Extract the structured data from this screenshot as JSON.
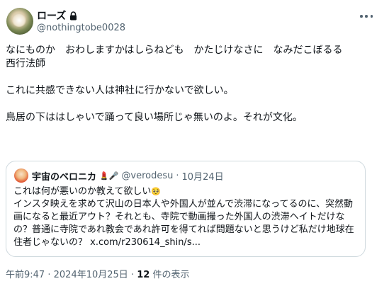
{
  "author": {
    "display_name": "ローズ",
    "handle": "@nothingtobe0028"
  },
  "icons": {
    "lock": "lock-icon",
    "more": "more-icon",
    "quote_emojis": "lipstick-microphone-icons",
    "pleading_face": "pleading-face-emoji"
  },
  "tweet": {
    "lines": [
      "なにものか　おわしますかはしらねども　かたじけなさに　なみだこぼるる",
      "西行法師",
      "",
      "これに共感できない人は神社に行かないで欲しい。",
      "",
      "鳥居の下ははしゃいで踊って良い場所じゃ無いのよ。それが文化。"
    ]
  },
  "quote": {
    "display_name": "宇宙のベロニカ",
    "emojis": "💄🎤",
    "handle": "@verodesu",
    "separator": "·",
    "date": "10月24日",
    "first_line": "これは何が悪いのか教えて欲しい",
    "first_line_emoji": "🥺",
    "body": "インスタ映えを求めて沢山の日本人や外国人が並んで渋滞になってるのに、突然動画になると最近アウト？それとも、寺院で動画撮った外国人の渋滞ヘイトだけなの？普通に寺院であれ教会であれ許可を得てれば問題ないと思うけど私だけ地球在住者じゃないの？ x.com/r230614_shin/s..."
  },
  "footer": {
    "time": "午前9:47",
    "separator": "·",
    "date": "2024年10月25日",
    "separator2": "·",
    "views_count": "12",
    "views_label": "件の表示"
  }
}
